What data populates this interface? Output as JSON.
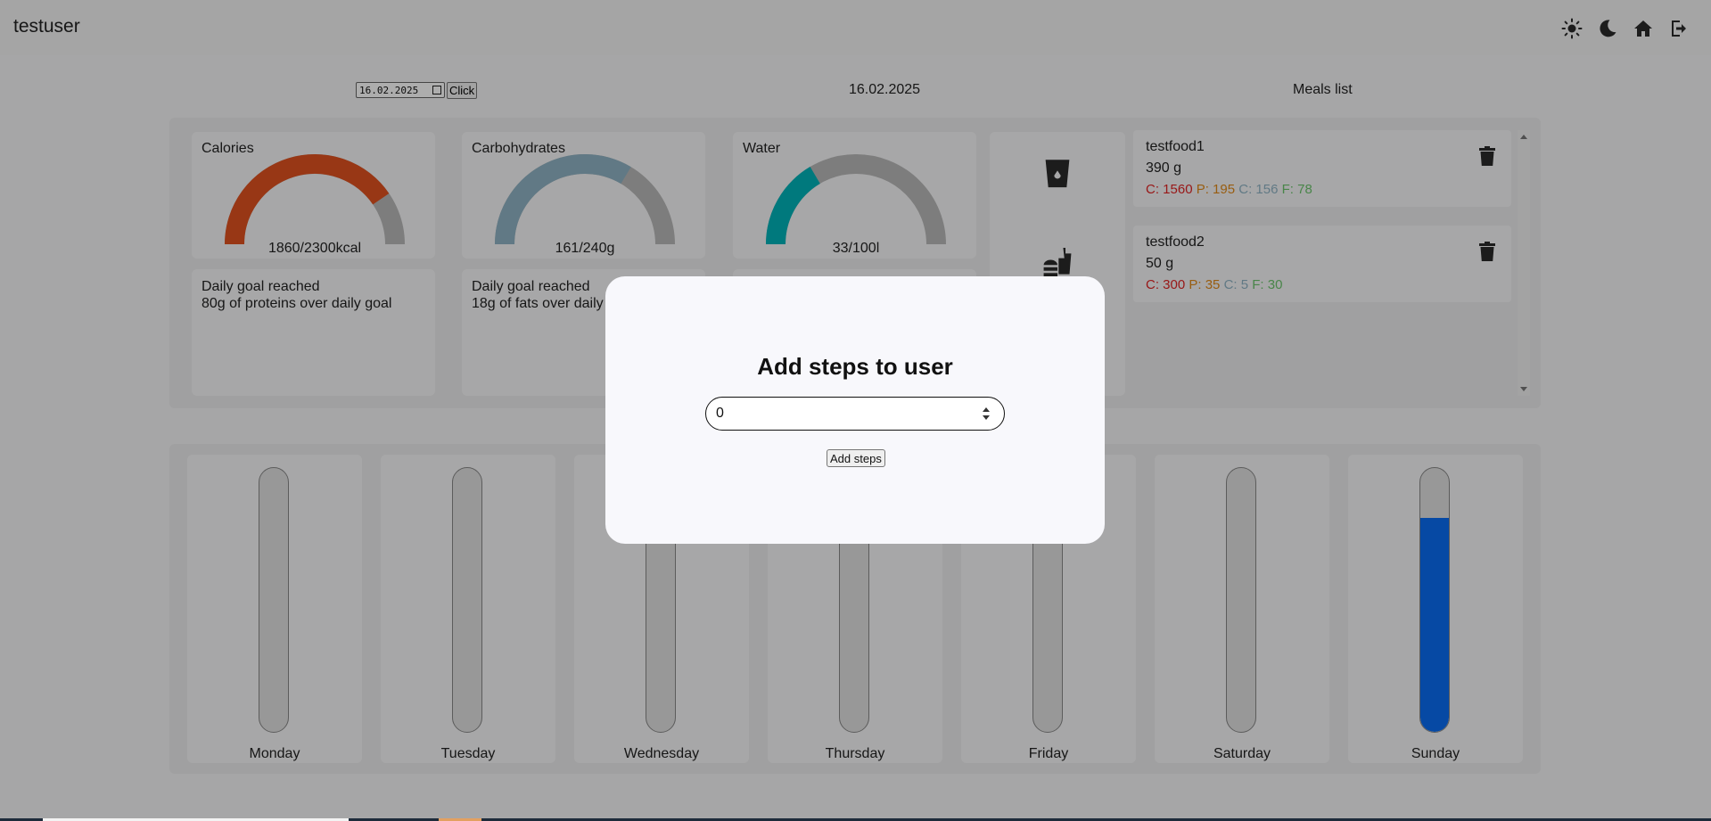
{
  "header": {
    "username": "testuser",
    "icons": [
      "sun-icon",
      "moon-icon",
      "home-icon",
      "logout-icon"
    ]
  },
  "date_bar": {
    "date_value": "16.02.2025",
    "click_label": "Click",
    "current_date": "16.02.2025",
    "meals_title": "Meals list"
  },
  "gauges": [
    {
      "title": "Calories",
      "label": "1860/2300kcal",
      "fraction": 0.809,
      "color": "#e0521f"
    },
    {
      "title": "Carbohydrates",
      "label": "161/240g",
      "fraction": 0.671,
      "color": "#8fb3c4"
    },
    {
      "title": "Water",
      "label": "33/100l",
      "fraction": 0.33,
      "color": "#00b3b8"
    }
  ],
  "info_cards": [
    {
      "line1": "Daily goal reached",
      "line2": "80g of proteins over daily goal"
    },
    {
      "line1": "Daily goal reached",
      "line2": "18g of fats over daily goal"
    }
  ],
  "meals": [
    {
      "name": "testfood1",
      "weight": "390 g",
      "c": "C: 1560",
      "p": "P: 195",
      "carb": "C: 156",
      "f": "F: 78"
    },
    {
      "name": "testfood2",
      "weight": "50 g",
      "c": "C: 300",
      "p": "P: 35",
      "carb": "C: 5",
      "f": "F: 30"
    }
  ],
  "steps": {
    "days": [
      {
        "label": "Monday",
        "fill": 0
      },
      {
        "label": "Tuesday",
        "fill": 0
      },
      {
        "label": "Wednesday",
        "fill": 0
      },
      {
        "label": "Thursday",
        "fill": 0
      },
      {
        "label": "Friday",
        "fill": 0
      },
      {
        "label": "Saturday",
        "fill": 0
      },
      {
        "label": "Sunday",
        "fill": 0.81
      }
    ]
  },
  "modal": {
    "title": "Add steps to user",
    "input_value": "0",
    "button_label": "Add steps"
  }
}
